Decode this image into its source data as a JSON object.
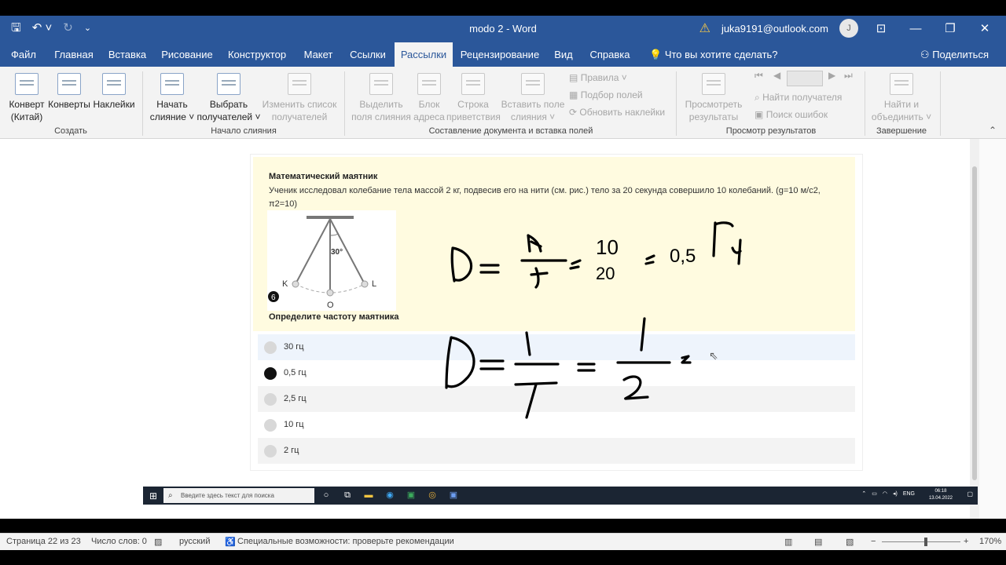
{
  "window": {
    "title": "modo 2  -  Word",
    "account": "juka9191@outlook.com",
    "avatar_initial": "J",
    "qat": {
      "save_icon": "save-icon",
      "undo_icon": "undo-icon",
      "redo_icon": "redo-icon",
      "customize_icon": "customize-icon"
    }
  },
  "tabs": [
    {
      "label": "Файл"
    },
    {
      "label": "Главная"
    },
    {
      "label": "Вставка"
    },
    {
      "label": "Рисование"
    },
    {
      "label": "Конструктор"
    },
    {
      "label": "Макет"
    },
    {
      "label": "Ссылки"
    },
    {
      "label": "Рассылки"
    },
    {
      "label": "Рецензирование"
    },
    {
      "label": "Вид"
    },
    {
      "label": "Справка"
    }
  ],
  "active_tab": "Рассылки",
  "tell_me": "Что вы хотите сделать?",
  "share": "Поделиться",
  "ribbon": {
    "groups": {
      "create": "Создать",
      "start_merge": "Начало слияния",
      "compose": "Составление документа и вставка полей",
      "preview": "Просмотр результатов",
      "finish": "Завершение"
    },
    "buttons": {
      "envelope_china": [
        "Конверт",
        "(Китай)"
      ],
      "envelopes": "Конверты",
      "labels": "Наклейки",
      "start_merge": [
        "Начать",
        "слияние ˅"
      ],
      "select_recipients": [
        "Выбрать",
        "получателей ˅"
      ],
      "edit_list": [
        "Изменить список",
        "получателей"
      ],
      "highlight_fields": [
        "Выделить",
        "поля слияния"
      ],
      "address_block": [
        "Блок",
        "адреса"
      ],
      "greeting_line": [
        "Строка",
        "приветствия"
      ],
      "insert_field": [
        "Вставить поле",
        "слияния ˅"
      ],
      "rules": "Правила ˅",
      "match_fields": "Подбор полей",
      "update_labels": "Обновить наклейки",
      "preview_results": [
        "Просмотреть",
        "результаты"
      ],
      "find_recipient": "Найти получателя",
      "check_errors": "Поиск ошибок",
      "finish_merge": [
        "Найти и",
        "объединить ˅"
      ]
    }
  },
  "question": {
    "title": "Математический маятник",
    "text": "Ученик исследовал колебание тела массой 2 кг, подвесив его на нити (см. рис.) тело за 20 секунда совершило 10 колебаний. (g=10 м/с2, π2=10)",
    "figure": {
      "angle": "30°",
      "left": "K",
      "right": "L",
      "bottom": "O",
      "badge": "6"
    },
    "ask": "Определите частоту маятника",
    "options": [
      "30 гц",
      "0,5 гц",
      "2,5 гц",
      "10 гц",
      "2 гц"
    ]
  },
  "handwriting": {
    "line1_result": "0,5",
    "unit": "Гц"
  },
  "taskbar": {
    "search_placeholder": "Введите здесь текст для поиска",
    "tray_lang": "ENG",
    "time": "06:18",
    "date": "13.04.2022"
  },
  "status": {
    "page": "Страница 22 из 23",
    "words": "Число слов: 0",
    "language": "русский",
    "accessibility": "Специальные возможности: проверьте рекомендации",
    "zoom": "170%"
  },
  "colors": {
    "word_blue": "#2b579a",
    "question_bg": "#fffbe0",
    "selected_option": "#eef4fc"
  }
}
